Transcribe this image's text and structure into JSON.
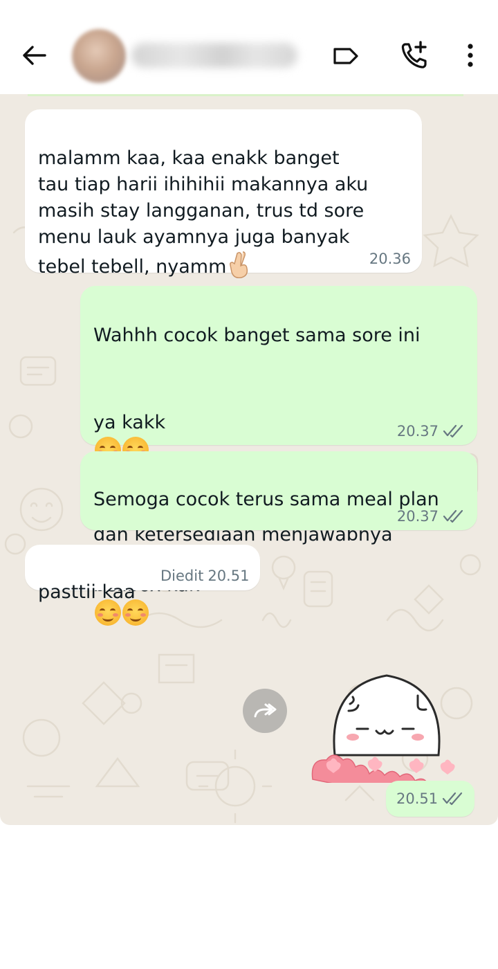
{
  "header": {
    "back_icon": "arrow-left-icon",
    "label_icon": "label-tag-icon",
    "call_icon": "add-call-icon",
    "more_icon": "more-vertical-icon",
    "contact_name": ""
  },
  "colors": {
    "chat_background": "#efeae2",
    "incoming_bubble": "#ffffff",
    "outgoing_bubble": "#d9fdd3",
    "read_tick": "#53bdeb",
    "timestamp": "#667781"
  },
  "messages": [
    {
      "direction": "incoming",
      "text": "malamm kaa, kaa enakk banget\ntau tiap harii ihihihii makannya aku\nmasih stay langganan, trus td sore\nmenu lauk ayamnya juga banyak\ntebel tebell, nyamm",
      "time": "20.36"
    },
    {
      "direction": "outgoing",
      "line1": "Wahhh cocok banget sama sore ini",
      "line2": "ya kakk",
      "line3": "Terimakasih banyak kak atas waktu\ndan ketersediaan menjawabnya",
      "time": "20.37"
    },
    {
      "direction": "outgoing",
      "line1": "Semoga cocok terus sama meal plan",
      "line2": "bellbox kak",
      "time": "20.37"
    },
    {
      "direction": "incoming",
      "text": "pasttii kaa",
      "edited_label": "Diedit",
      "time": "20.51"
    },
    {
      "direction": "outgoing",
      "type": "sticker",
      "time": "20.51"
    }
  ]
}
